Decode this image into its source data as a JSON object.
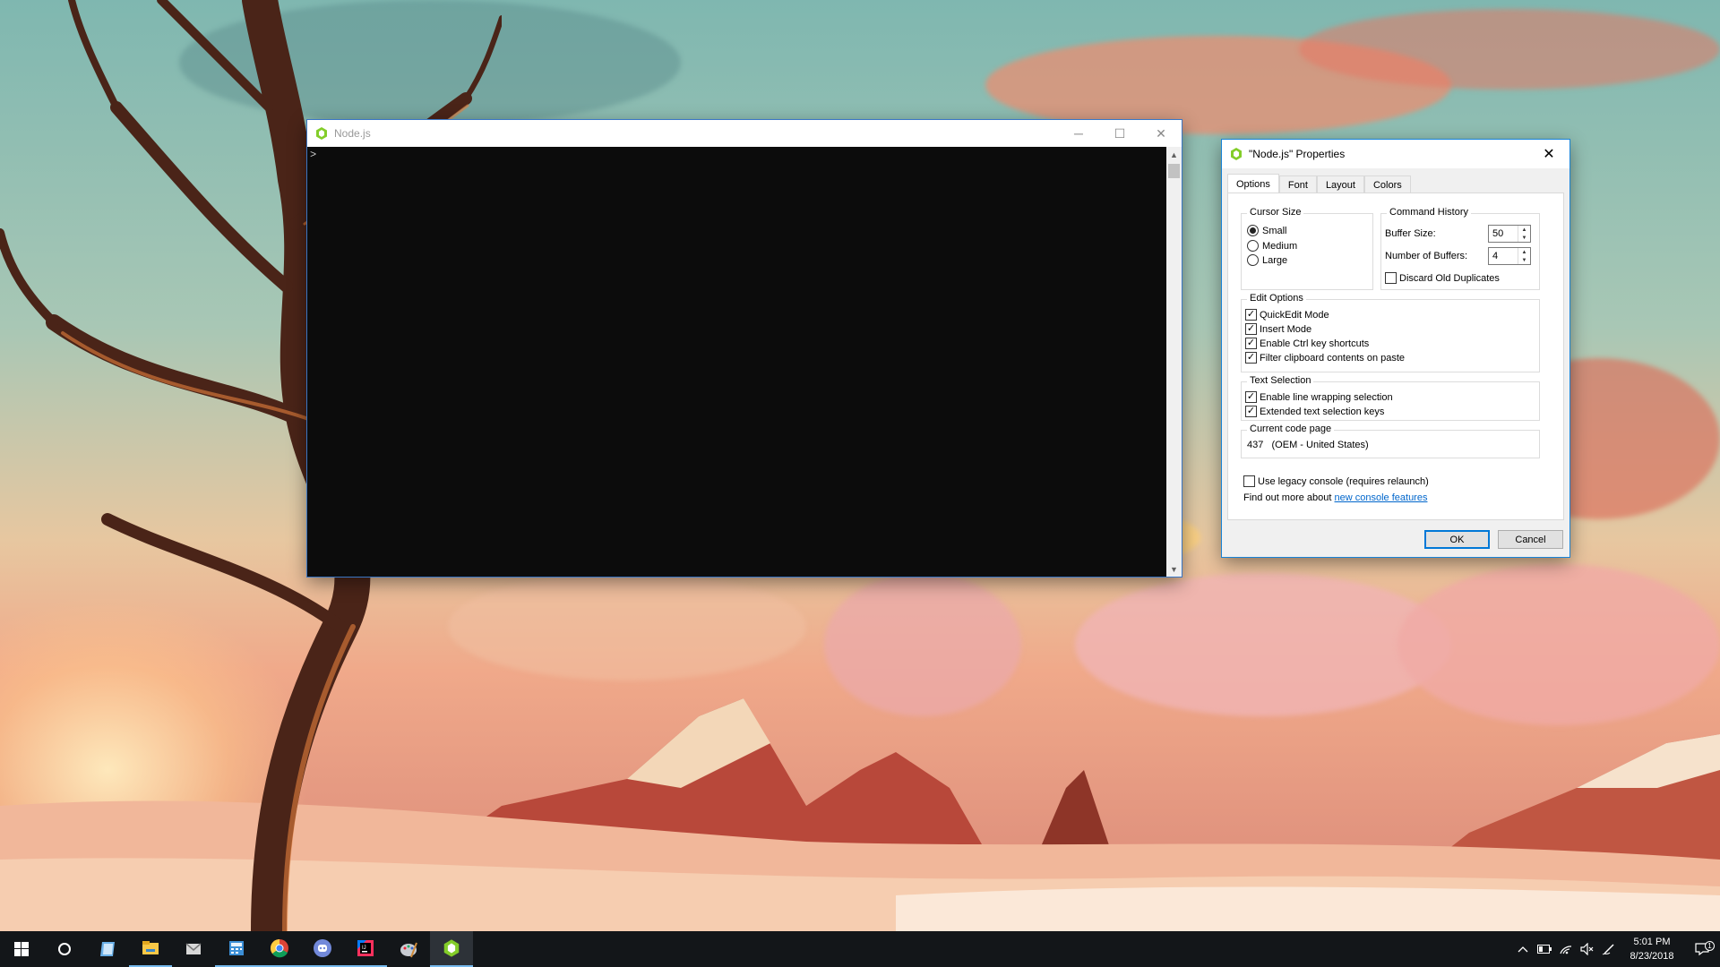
{
  "console": {
    "title": "Node.js",
    "prompt": ">",
    "minimize_glyph": "─",
    "maximize_glyph": "☐",
    "close_glyph": "✕"
  },
  "props": {
    "title": "\"Node.js\" Properties",
    "close_glyph": "✕",
    "tabs": [
      {
        "label": "Options",
        "active": true
      },
      {
        "label": "Font",
        "active": false
      },
      {
        "label": "Layout",
        "active": false
      },
      {
        "label": "Colors",
        "active": false
      }
    ],
    "cursor_size": {
      "label": "Cursor Size",
      "options": [
        {
          "label": "Small",
          "selected": true
        },
        {
          "label": "Medium",
          "selected": false
        },
        {
          "label": "Large",
          "selected": false
        }
      ]
    },
    "command_history": {
      "label": "Command History",
      "buffer_size_label": "Buffer Size:",
      "buffer_size_value": "50",
      "num_buffers_label": "Number of Buffers:",
      "num_buffers_value": "4",
      "discard_label": "Discard Old Duplicates",
      "discard_checked": false
    },
    "edit_options": {
      "label": "Edit Options",
      "items": [
        {
          "label": "QuickEdit Mode",
          "checked": true
        },
        {
          "label": "Insert Mode",
          "checked": true
        },
        {
          "label": "Enable Ctrl key shortcuts",
          "checked": true
        },
        {
          "label": "Filter clipboard contents on paste",
          "checked": true
        }
      ]
    },
    "text_selection": {
      "label": "Text Selection",
      "items": [
        {
          "label": "Enable line wrapping selection",
          "checked": true
        },
        {
          "label": "Extended text selection keys",
          "checked": true
        }
      ]
    },
    "code_page": {
      "label": "Current code page",
      "value": "437   (OEM - United States)"
    },
    "legacy": {
      "label": "Use legacy console (requires relaunch)",
      "checked": false
    },
    "find_more": {
      "prefix": "Find out more about ",
      "link": "new console features"
    },
    "ok_label": "OK",
    "cancel_label": "Cancel"
  },
  "taskbar": {
    "icons": [
      "windows-start-icon",
      "cortana-icon",
      "notepad-icon",
      "file-explorer-icon",
      "mail-icon",
      "calculator-icon",
      "chrome-icon",
      "discord-icon",
      "intellij-icon",
      "paint-icon",
      "nodejs-icon"
    ],
    "clock_time": "5:01 PM",
    "clock_date": "8/23/2018",
    "notification_count": "1"
  }
}
